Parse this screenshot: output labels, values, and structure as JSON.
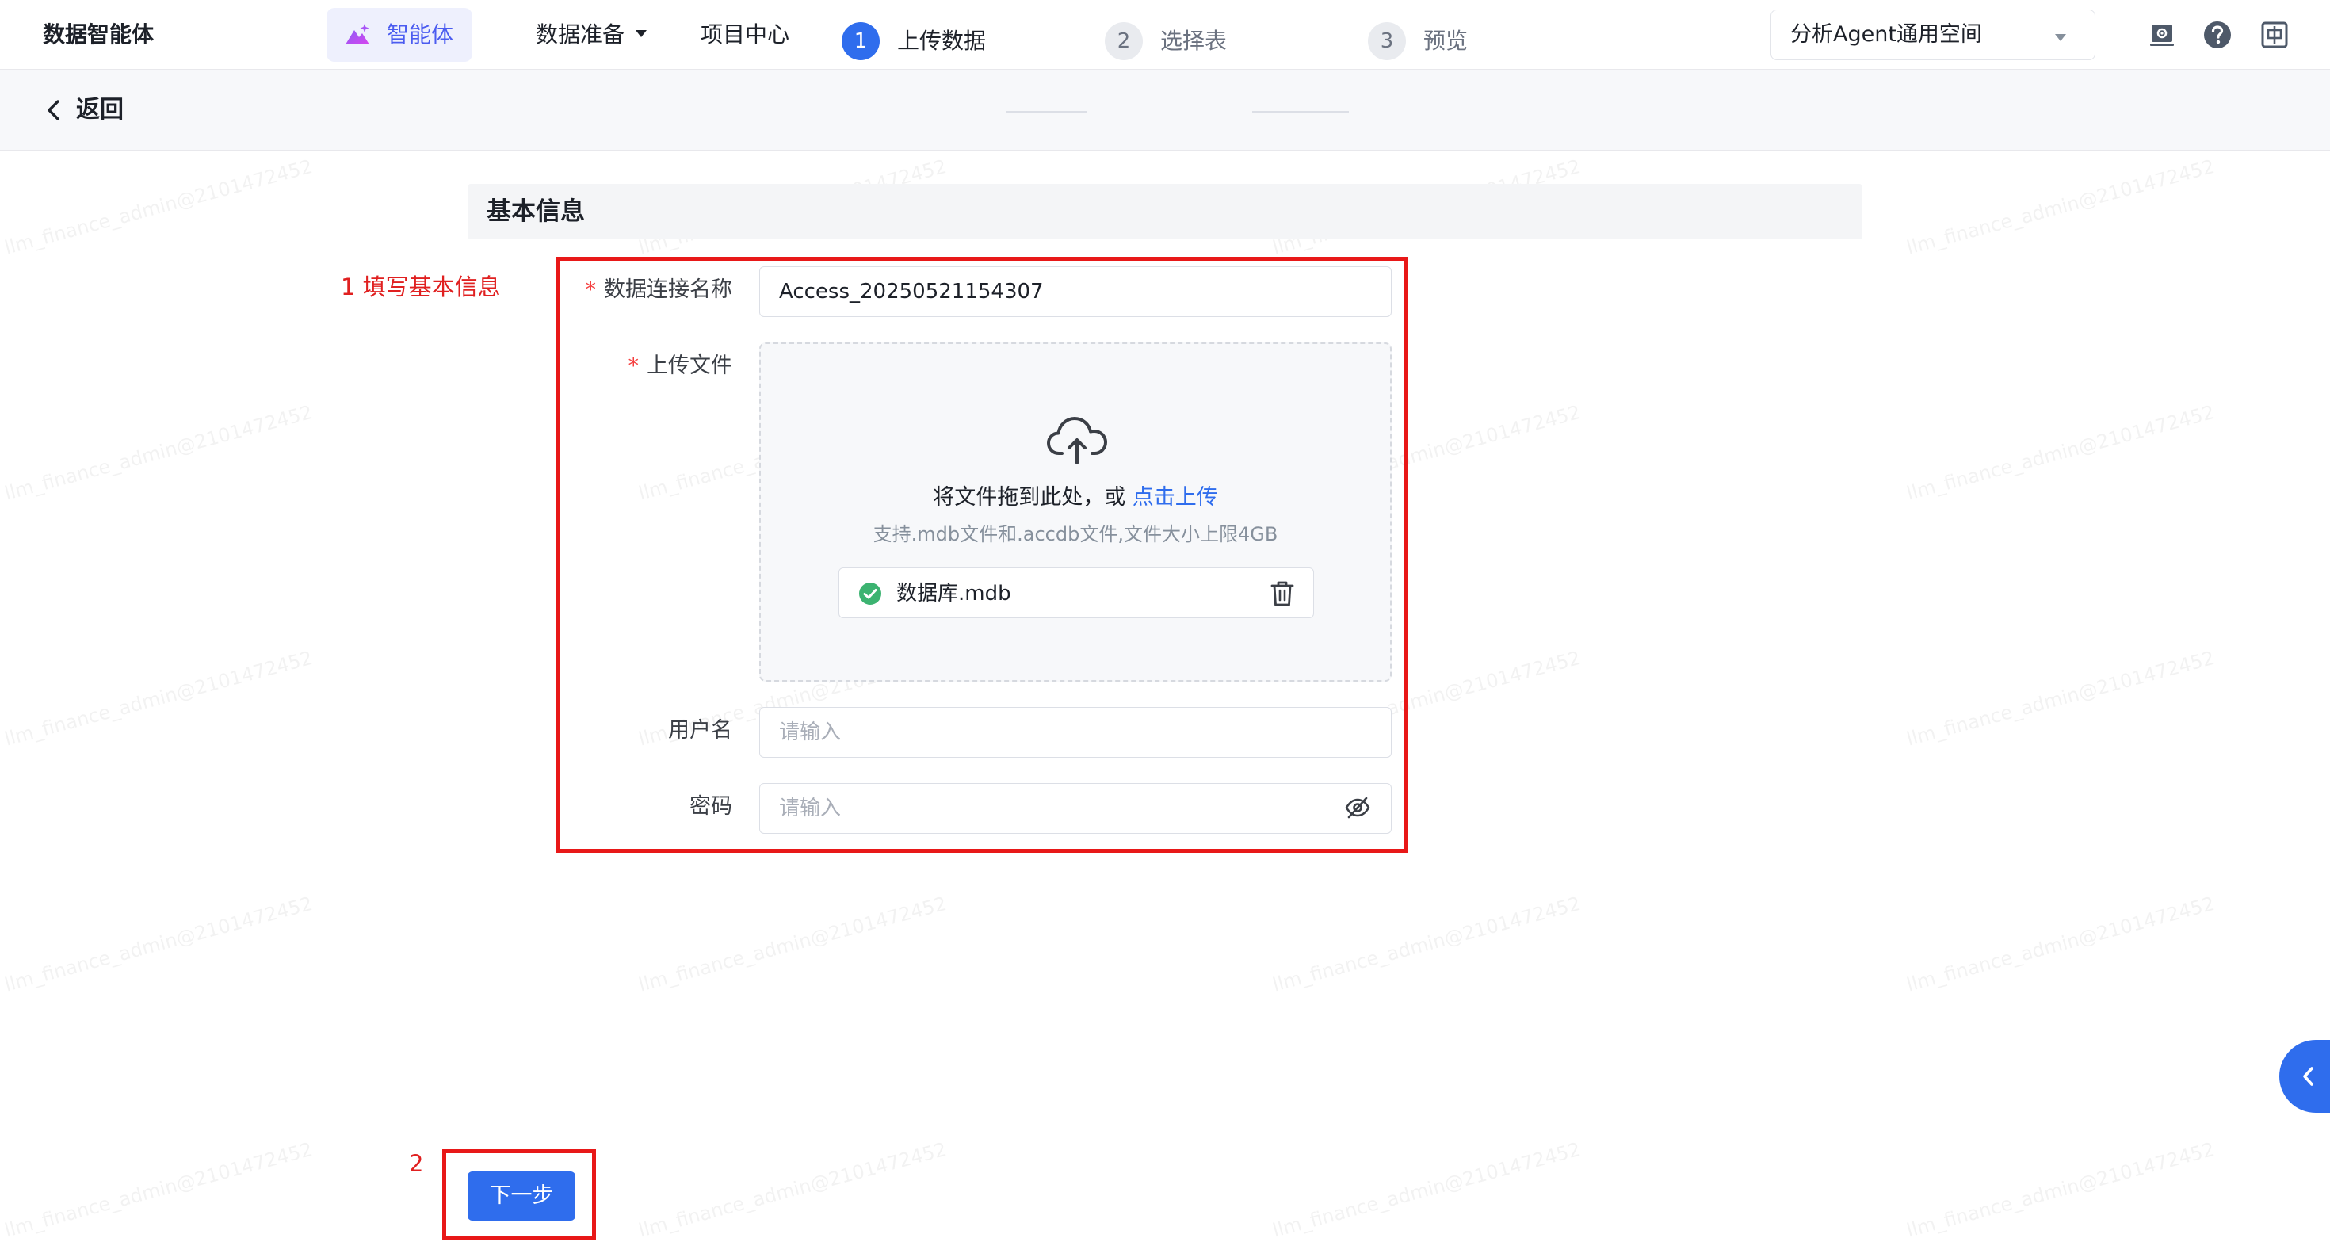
{
  "app": {
    "name": "数据智能体"
  },
  "nav": {
    "agent_label": "智能体",
    "data_prep_label": "数据准备",
    "project_center_label": "项目中心"
  },
  "workspace": {
    "selected": "分析Agent通用空间"
  },
  "header_icons": [
    "settings-icon",
    "help-icon",
    "language-icon"
  ],
  "subheader": {
    "back_label": "返回",
    "steps": [
      {
        "number": "1",
        "label": "上传数据",
        "state": "active"
      },
      {
        "number": "2",
        "label": "选择表",
        "state": "inactive"
      },
      {
        "number": "3",
        "label": "预览",
        "state": "inactive"
      }
    ]
  },
  "watermark": {
    "text": "llm_finance_admin@2101472452"
  },
  "section": {
    "title": "基本信息"
  },
  "annotations": {
    "step1": "1 填写基本信息",
    "step2": "2",
    "color": "#e81818"
  },
  "form": {
    "connection_name": {
      "required_mark": "*",
      "label": "数据连接名称",
      "value": "Access_20250521154307"
    },
    "upload": {
      "required_mark": "*",
      "label": "上传文件",
      "drag_text": "将文件拖到此处，或",
      "click_text": "点击上传",
      "hint": "支持.mdb文件和.accdb文件,文件大小上限4GB",
      "file": {
        "name": "数据库.mdb",
        "status": "success"
      }
    },
    "username": {
      "label": "用户名",
      "placeholder": "请输入",
      "value": ""
    },
    "password": {
      "label": "密码",
      "placeholder": "请输入",
      "value": ""
    }
  },
  "actions": {
    "next_label": "下一步"
  },
  "colors": {
    "primary": "#2f6ded",
    "agent_accent": "#4b5cf0",
    "success": "#3cb371",
    "required": "#f53f3f"
  }
}
